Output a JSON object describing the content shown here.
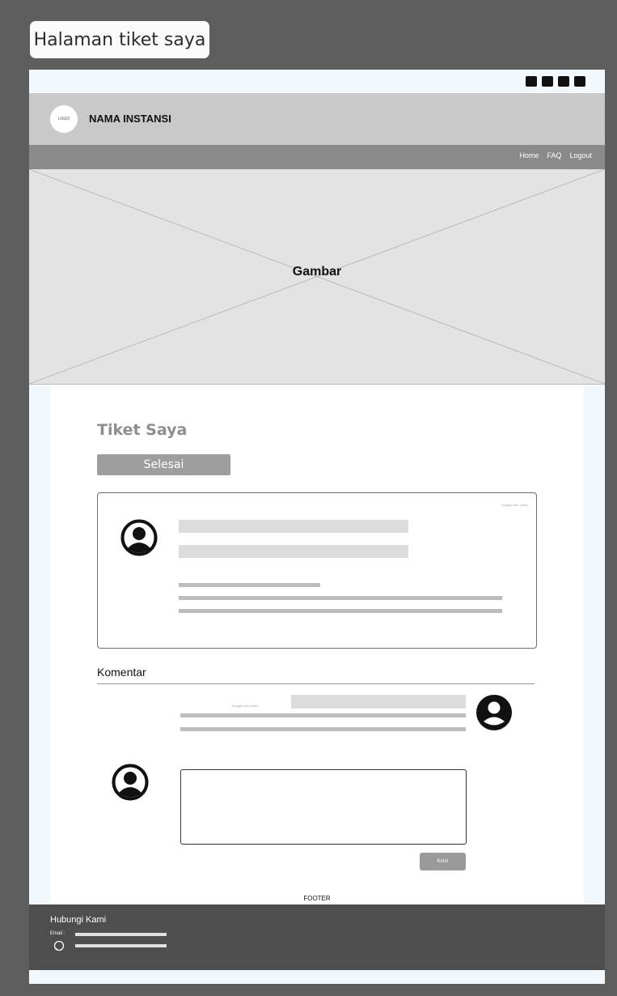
{
  "frame_label": "Halaman tiket saya",
  "social_icons": [
    "youtube-icon",
    "twitter-icon",
    "instagram-icon",
    "mail-icon"
  ],
  "header": {
    "logo": "LOGO",
    "brand": "NAMA INSTANSI"
  },
  "nav": {
    "home": "Home",
    "faq": "FAQ",
    "logout": "Logout"
  },
  "hero": {
    "label": "Gambar"
  },
  "page": {
    "title": "Tiket Saya",
    "status_button": "Selesai"
  },
  "ticket": {
    "date": "Tanggal dan waktu"
  },
  "comments": {
    "label": "Komentar",
    "date": "Tanggal dan waktu",
    "send_button": "Kirim"
  },
  "footer": {
    "label": "FOOTER",
    "contact_title": "Hubungi Kami",
    "email_label": "Email :"
  }
}
